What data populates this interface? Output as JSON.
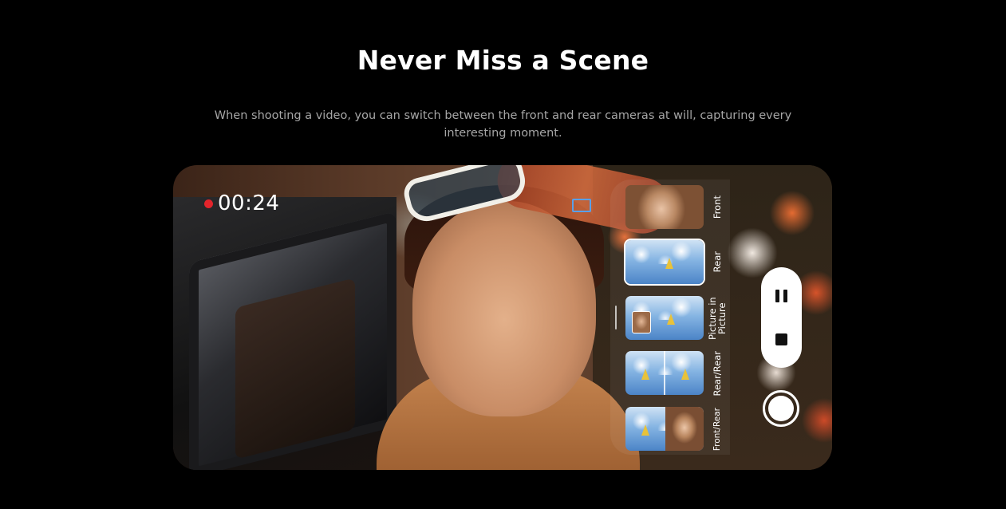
{
  "header": {
    "title": "Never Miss a Scene",
    "subtitle": "When shooting a video, you can switch between the front and rear cameras at will, capturing every interesting moment."
  },
  "camera": {
    "recording_time": "00:24",
    "modes": [
      {
        "label": "Front",
        "selected": false
      },
      {
        "label": "Rear",
        "selected": true
      },
      {
        "label": "Picture in Picture",
        "selected": false
      },
      {
        "label": "Rear/Rear",
        "selected": false
      },
      {
        "label": "Front/Rear",
        "selected": false
      }
    ]
  },
  "colors": {
    "background": "#000000",
    "recording_dot": "#e3242b",
    "subtitle_text": "#a6a6a6",
    "accent_blue": "#5aa0e8"
  },
  "icons": {
    "recording": "red-dot-icon",
    "aspect": "screen-ratio-icon",
    "pause": "pause-icon",
    "stop": "stop-icon",
    "capture": "shutter-icon"
  }
}
